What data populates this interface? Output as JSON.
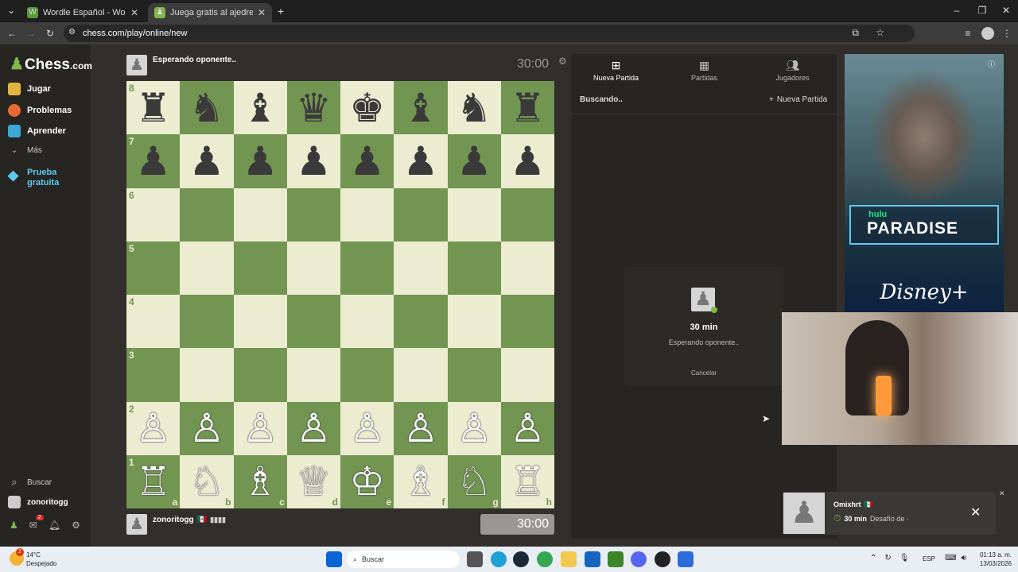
{
  "browser": {
    "tabs": [
      {
        "title": "Wordle Español - Wordle ilimitado",
        "favicon_color": "#5a9a3c",
        "favicon_letter": "W"
      },
      {
        "title": "Juega gratis al ajedrez online con",
        "favicon_color": "#81b64c",
        "favicon_letter": "♟"
      }
    ],
    "url": "chess.com/play/online/new"
  },
  "sidebar": {
    "logo": "Chess",
    "logo_suffix": ".com",
    "items": [
      {
        "label": "Jugar",
        "icon": "pawn-icon",
        "color": "#e3b341"
      },
      {
        "label": "Problemas",
        "icon": "puzzle-icon",
        "color": "#e86a33"
      },
      {
        "label": "Aprender",
        "icon": "graduation-icon",
        "color": "#3fa7d6"
      },
      {
        "label": "Más",
        "icon": "chevron-down-icon",
        "color": "#aaaaaa"
      }
    ],
    "trial_line1": "Prueba",
    "trial_line2": "gratuita",
    "search_label": "Buscar",
    "username": "zonoritogg",
    "mail_badge": "2"
  },
  "game": {
    "opponent_label": "Esperando oponente..",
    "opponent_clock": "30:00",
    "player_name": "zonoritogg",
    "player_flag": "🇲🇽",
    "player_clock": "30:00"
  },
  "board": {
    "ranks": [
      "8",
      "7",
      "6",
      "5",
      "4",
      "3",
      "2",
      "1"
    ],
    "files": [
      "a",
      "b",
      "c",
      "d",
      "e",
      "f",
      "g",
      "h"
    ],
    "rows": [
      [
        "♜",
        "♞",
        "♝",
        "♛",
        "♚",
        "♝",
        "♞",
        "♜"
      ],
      [
        "♟",
        "♟",
        "♟",
        "♟",
        "♟",
        "♟",
        "♟",
        "♟"
      ],
      [
        "",
        "",
        "",
        "",
        "",
        "",
        "",
        ""
      ],
      [
        "",
        "",
        "",
        "",
        "",
        "",
        "",
        ""
      ],
      [
        "",
        "",
        "",
        "",
        "",
        "",
        "",
        ""
      ],
      [
        "",
        "",
        "",
        "",
        "",
        "",
        "",
        ""
      ],
      [
        "♙",
        "♙",
        "♙",
        "♙",
        "♙",
        "♙",
        "♙",
        "♙"
      ],
      [
        "♖",
        "♘",
        "♗",
        "♕",
        "♔",
        "♗",
        "♘",
        "♖"
      ]
    ]
  },
  "panel": {
    "tabs": [
      {
        "label": "Nueva Partida",
        "icon": "plus-square-icon"
      },
      {
        "label": "Partidas",
        "icon": "board-icon"
      },
      {
        "label": "Jugadores",
        "icon": "players-icon"
      }
    ],
    "searching": "Buscando..",
    "new_game": "Nueva Partida",
    "time": "30 min",
    "waiting": "Esperando oponente..",
    "cancel": "Cancelar"
  },
  "ad": {
    "brand": "hulu",
    "title": "PARADISE",
    "partner": "Disney+"
  },
  "challenge": {
    "user": "Omixhrt",
    "flag": "🇲🇽",
    "time": "30 min",
    "text": "Desafío de ·"
  },
  "taskbar": {
    "weather_temp": "14°C",
    "weather_desc": "Despejado",
    "search": "Buscar",
    "lang": "ESP",
    "time": "01:13 a. m.",
    "date": "13/03/2026"
  }
}
